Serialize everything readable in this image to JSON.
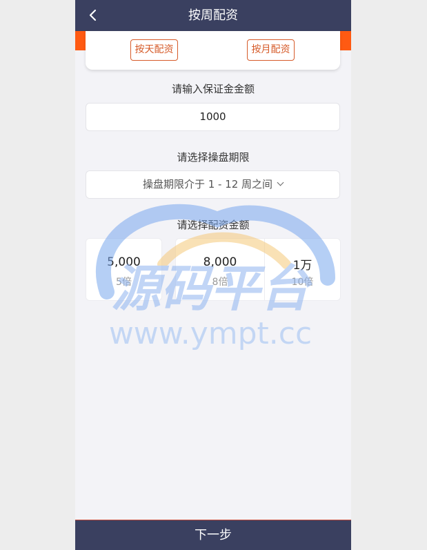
{
  "header": {
    "title": "按周配资",
    "back_icon": "chevron-left-icon"
  },
  "type_tabs": [
    {
      "label": "按天配资"
    },
    {
      "label": "按月配资"
    }
  ],
  "deposit": {
    "label": "请输入保证金金额",
    "value": "1000"
  },
  "period": {
    "label": "请选择操盘期限",
    "value": "操盘期限介于 1 - 12 周之间",
    "icon": "chevron-down-icon"
  },
  "amounts": {
    "label": "请选择配资金额",
    "options": [
      {
        "value": "5,000",
        "multiple": "5倍"
      },
      {
        "value": "8,000",
        "multiple": "8倍"
      },
      {
        "value": "1万",
        "multiple": "10倍"
      }
    ]
  },
  "watermark": {
    "title": "源码平台",
    "url": "www.ympt.cc"
  },
  "footer": {
    "next_label": "下一步"
  },
  "colors": {
    "header_bg": "#3a4060",
    "accent": "#ff5a12",
    "button_border": "#d65a28",
    "page_bg": "#f3f3f7"
  }
}
